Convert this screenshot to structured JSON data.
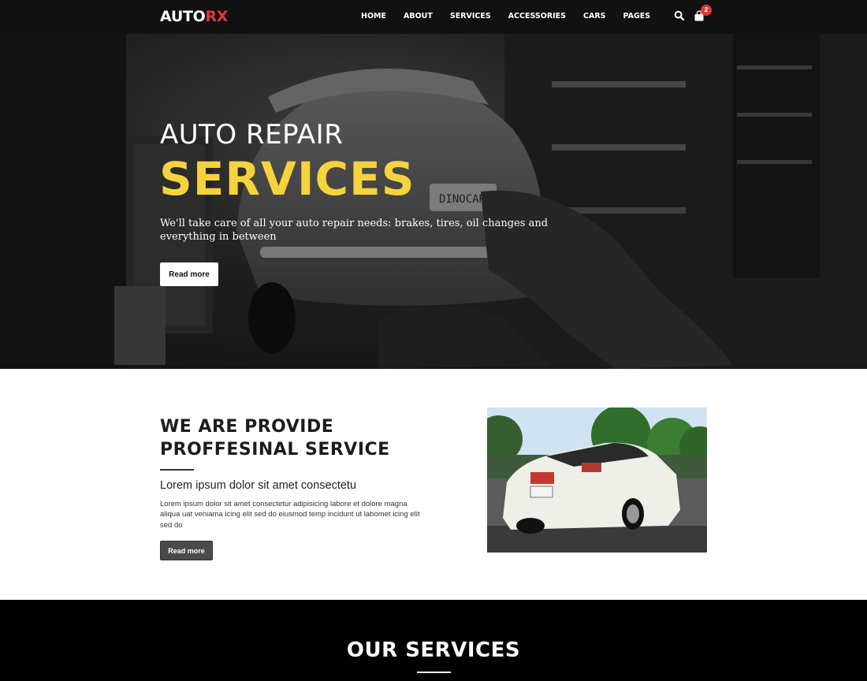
{
  "nav": {
    "logo_part1": "AUTO",
    "logo_part2": "RX",
    "items": [
      "HOME",
      "ABOUT",
      "SERVICES",
      "ACCESSORIES",
      "CARS",
      "PAGES"
    ],
    "search_icon": "search-icon",
    "cart_icon": "shopping-bag-icon",
    "cart_count": "2"
  },
  "hero": {
    "subtitle": "AUTO REPAIR",
    "title": "SERVICES",
    "text": "We'll take care of all your auto repair needs: brakes, tires, oil changes and everything in between",
    "button": "Read more",
    "plate_text": "DINOCAR"
  },
  "about": {
    "title_line1": "WE ARE PROVIDE",
    "title_line2": "PROFFESINAL SERVICE",
    "lead": "Lorem ipsum dolor sit amet consectetu",
    "body": "Lorem ipsum dolor sit amet consectetur adipisicing labore et dolore magna aliqua uat veniama icing elit sed do eiusmod temp incidunt ut labomet icing elit sed do",
    "button": "Read more"
  },
  "services": {
    "title": "OUR SERVICES"
  },
  "colors": {
    "accent_yellow": "#f5d33c",
    "brand_red": "#e03a3a",
    "nav_bg": "#111111"
  }
}
